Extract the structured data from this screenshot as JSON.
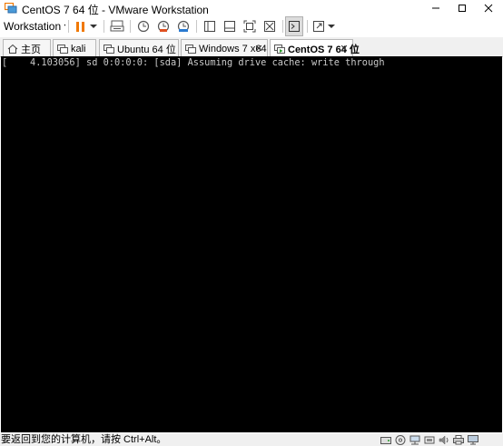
{
  "window": {
    "title": "CentOS 7 64 位 - VMware Workstation",
    "app_icon": "vmware-logo-icon",
    "controls": [
      "minimize-icon",
      "maximize-icon",
      "close-icon"
    ]
  },
  "toolbar": {
    "menu_label": "Workstation",
    "items": [
      {
        "name": "pause-icon",
        "color": "#f07800"
      },
      {
        "name": "send-ctrl-alt-del-icon"
      },
      {
        "name": "snapshot-icon"
      },
      {
        "name": "revert-snapshot-icon"
      },
      {
        "name": "snapshot-manager-icon"
      },
      {
        "name": "show-library-icon"
      },
      {
        "name": "thumbnail-bar-icon"
      },
      {
        "name": "full-screen-icon"
      },
      {
        "name": "unity-icon"
      },
      {
        "name": "console-view-icon"
      },
      {
        "name": "stretch-guest-icon"
      }
    ]
  },
  "tabs": [
    {
      "label": "主页",
      "icon": "home-icon",
      "active": false
    },
    {
      "label": "kali",
      "icon": "vm-icon",
      "active": false
    },
    {
      "label": "Ubuntu 64 位",
      "icon": "vm-icon",
      "active": false
    },
    {
      "label": "Windows 7 x64",
      "icon": "vm-icon",
      "active": false
    },
    {
      "label": "CentOS 7 64 位",
      "icon": "vm-running-icon",
      "active": true
    }
  ],
  "console": {
    "lines": [
      "[    4.103056] sd 0:0:0:0: [sda] Assuming drive cache: write through"
    ]
  },
  "statusbar": {
    "text": "要返回到您的计算机，请按 Ctrl+Alt。",
    "icons": [
      "hard-disk-icon",
      "cd-dvd-icon",
      "network-icon",
      "usb-icon",
      "sound-icon",
      "printer-icon",
      "display-icon"
    ]
  },
  "colors": {
    "accent": "#f07800",
    "screen_bg": "#000000",
    "console_text": "#c9c9c9"
  }
}
